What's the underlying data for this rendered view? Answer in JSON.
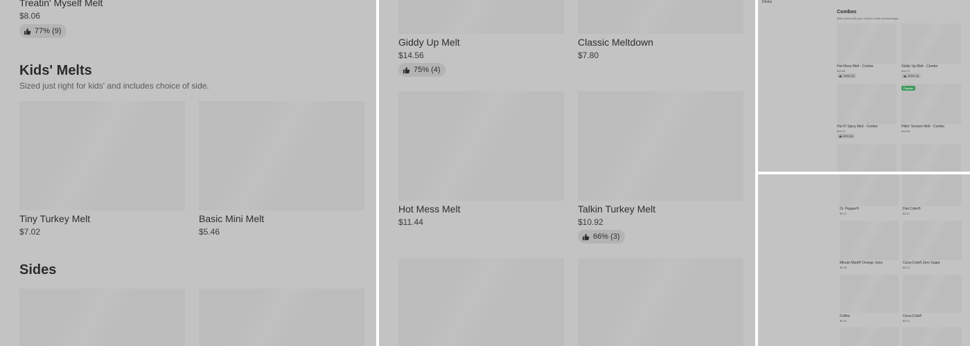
{
  "colors": {
    "panel_bg": "#c3c3c3",
    "placeholder": "#bcbcbc",
    "badge_green": "#3f9a5d"
  },
  "panel1": {
    "top_item": {
      "name": "Treatin' Myself Melt",
      "price": "$8.06",
      "rating": "77% (9)"
    },
    "kids_section": {
      "title": "Kids' Melts",
      "subtitle": "Sized just right for kids' and includes choice of side.",
      "items": [
        {
          "name": "Tiny Turkey Melt",
          "price": "$7.02"
        },
        {
          "name": "Basic Mini Melt",
          "price": "$5.46"
        }
      ]
    },
    "sides_section": {
      "title": "Sides"
    }
  },
  "panel2": {
    "items": [
      {
        "name": "Giddy Up Melt",
        "price": "$14.56",
        "rating": "75% (4)"
      },
      {
        "name": "Classic Meltdown",
        "price": "$7.80"
      },
      {
        "name": "Hot Mess Melt",
        "price": "$11.44"
      },
      {
        "name": "Talkin Turkey Melt",
        "price": "$10.92",
        "rating": "66% (3)"
      }
    ]
  },
  "panel3": {
    "sidebar_item": "Drinks",
    "combos_title": "Combos",
    "combos_subtitle": "Melt comes with your choice of side and beverage",
    "items": [
      {
        "name": "Hot Mess Melt - Combo",
        "price": "$15.60",
        "rating": "100% (3)"
      },
      {
        "name": "Giddy Up Melt - Combo",
        "price": "$18.72",
        "rating": "100% (3)"
      },
      {
        "name": "Hot N' Spicy Melt - Combo",
        "price": "$15.12",
        "rating": "80% (5)"
      },
      {
        "name": "Hittin' Snooze Melt - Combo",
        "price": "$16.64",
        "badge": "Popular"
      }
    ]
  },
  "panel4": {
    "items": [
      {
        "name": "Dr. Pepper®",
        "price": "$3.12"
      },
      {
        "name": "Diet Coke®",
        "price": "$3.12"
      },
      {
        "name": "Minute Maid® Orange Juice",
        "price": "$3.38"
      },
      {
        "name": "Coca-Cola® Zero Sugar",
        "price": "$3.12"
      },
      {
        "name": "Coffee",
        "price": "$2.60"
      },
      {
        "name": "Coca-Cola®",
        "price": "$3.12"
      }
    ]
  },
  "icons": {
    "rating": "thumbs-up-icon"
  }
}
